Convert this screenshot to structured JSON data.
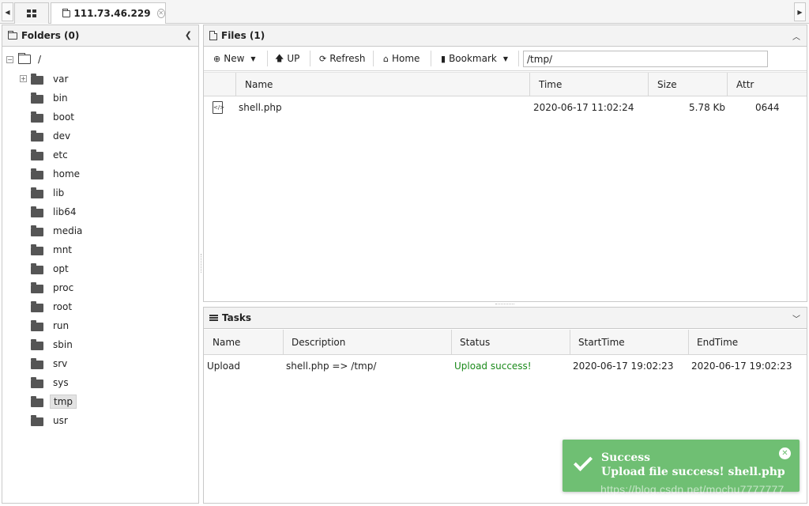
{
  "tabs": {
    "scroll_left": "◀",
    "scroll_right": "▶",
    "host": "111.73.46.229",
    "close_glyph": "✕"
  },
  "folders": {
    "title": "Folders (0)",
    "collapse_glyph": "❮",
    "root": "/",
    "items": [
      {
        "label": "var",
        "expandable": true
      },
      {
        "label": "bin"
      },
      {
        "label": "boot"
      },
      {
        "label": "dev"
      },
      {
        "label": "etc"
      },
      {
        "label": "home"
      },
      {
        "label": "lib"
      },
      {
        "label": "lib64"
      },
      {
        "label": "media"
      },
      {
        "label": "mnt"
      },
      {
        "label": "opt"
      },
      {
        "label": "proc"
      },
      {
        "label": "root"
      },
      {
        "label": "run"
      },
      {
        "label": "sbin"
      },
      {
        "label": "srv"
      },
      {
        "label": "sys"
      },
      {
        "label": "tmp",
        "selected": true
      },
      {
        "label": "usr"
      }
    ]
  },
  "files": {
    "title": "Files (1)",
    "toolbar": {
      "new_label": "New",
      "up_label": "UP",
      "refresh_label": "Refresh",
      "home_label": "Home",
      "bookmark_label": "Bookmark",
      "path": "/tmp/"
    },
    "columns": [
      "Name",
      "Time",
      "Size",
      "Attr"
    ],
    "rows": [
      {
        "name": "shell.php",
        "time": "2020-06-17 11:02:24",
        "size": "5.78 Kb",
        "attr": "0644"
      }
    ]
  },
  "tasks": {
    "title": "Tasks",
    "columns": [
      "Name",
      "Description",
      "Status",
      "StartTime",
      "EndTime"
    ],
    "rows": [
      {
        "name": "Upload",
        "description": "shell.php => /tmp/",
        "status": "Upload success!",
        "start": "2020-06-17 19:02:23",
        "end": "2020-06-17 19:02:23"
      }
    ]
  },
  "toast": {
    "title": "Success",
    "message": "Upload file success! shell.php",
    "close_glyph": "✕"
  },
  "watermark": "https://blog.csdn.net/mochu7777777",
  "colors": {
    "toast_bg": "#6fbf73",
    "status_success": "#1b8a1b"
  }
}
